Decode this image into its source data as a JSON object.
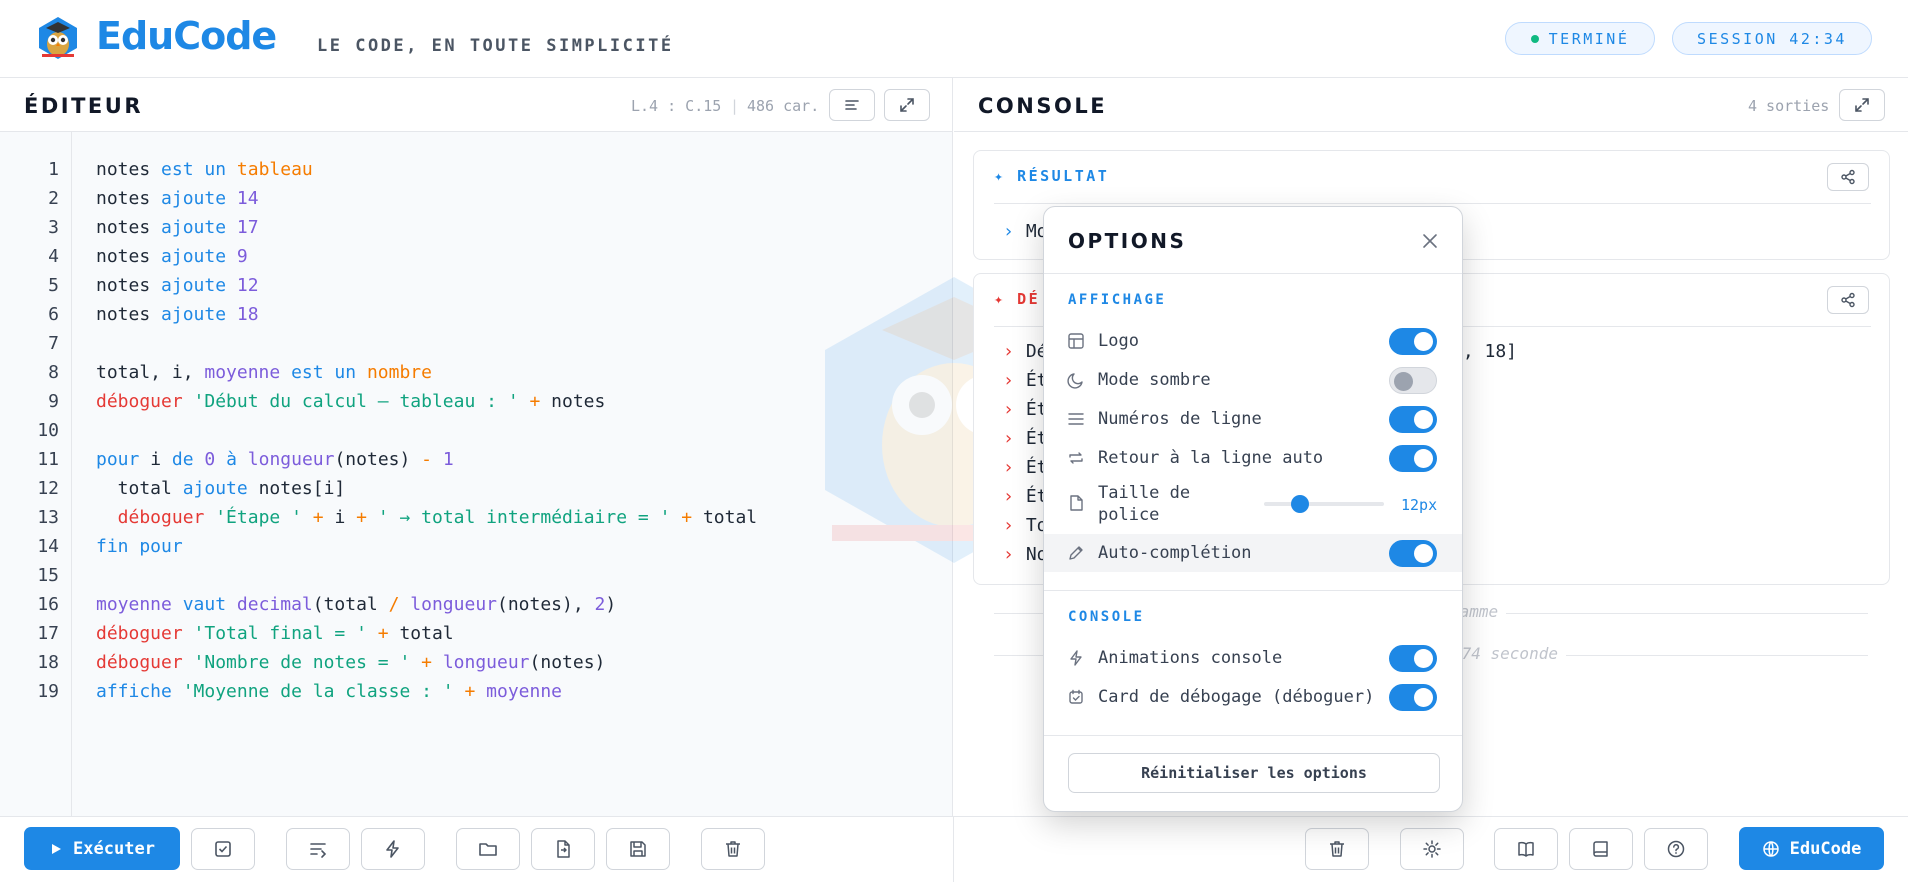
{
  "header": {
    "brand": "EduCode",
    "tagline": "LE CODE, EN TOUTE SIMPLICITÉ",
    "status_badge": "TERMINÉ",
    "session_badge": "SESSION 42:34"
  },
  "editor": {
    "title": "ÉDITEUR",
    "position": "L.4 : C.15",
    "separator": "|",
    "char_count": "486 car.",
    "line_numbers": [
      "1",
      "2",
      "3",
      "4",
      "5",
      "6",
      "7",
      "8",
      "9",
      "10",
      "11",
      "12",
      "13",
      "14",
      "15",
      "16",
      "17",
      "18",
      "19"
    ],
    "code": {
      "l1": [
        "notes ",
        "est un ",
        "tableau"
      ],
      "l2": [
        "notes ",
        "ajoute ",
        "14"
      ],
      "l3": [
        "notes ",
        "ajoute ",
        "17"
      ],
      "l4": [
        "notes ",
        "ajoute ",
        "9"
      ],
      "l5": [
        "notes ",
        "ajoute ",
        "12"
      ],
      "l6": [
        "notes ",
        "ajoute ",
        "18"
      ],
      "l8": [
        "total, i, ",
        "moyenne ",
        "est un ",
        "nombre"
      ],
      "l9": [
        "déboguer ",
        "'Début du calcul — tableau : '",
        " + ",
        "notes"
      ],
      "l11": [
        "pour ",
        "i ",
        "de ",
        "0 ",
        "à ",
        "longueur",
        "(notes) ",
        "- ",
        "1"
      ],
      "l12": [
        "  total ",
        "ajoute ",
        "notes[i]"
      ],
      "l13": [
        "  déboguer ",
        "'Étape '",
        " + ",
        "i ",
        "+ ",
        "' → total intermédiaire = '",
        " + ",
        "total"
      ],
      "l14": [
        "fin pour"
      ],
      "l16": [
        "moyenne ",
        "vaut ",
        "decimal",
        "(total ",
        "/ ",
        "longueur",
        "(notes), ",
        "2",
        ")"
      ],
      "l17": [
        "déboguer ",
        "'Total final = '",
        " + ",
        "total"
      ],
      "l18": [
        "déboguer ",
        "'Nombre de notes = '",
        " + ",
        "longueur",
        "(notes)"
      ],
      "l19": [
        "affiche ",
        "'Moyenne de la classe : '",
        " + ",
        "moyenne"
      ]
    }
  },
  "console": {
    "title": "CONSOLE",
    "output_count": "4 sorties",
    "result_title": "RÉSULTAT",
    "result_line": "Moy",
    "debug_title": "DÉ",
    "debug_lines": [
      "Déb",
      "Éta",
      "Éta",
      "Éta",
      "Éta",
      "Éta",
      "Tot",
      "Nom"
    ],
    "debug_tail": "2, 18]",
    "sep1_text": "ramme",
    "sep2_text": ".74 seconde"
  },
  "footer": {
    "run_label": "Exécuter",
    "brand_button": "EduCode"
  },
  "options": {
    "title": "OPTIONS",
    "section_display": "AFFICHAGE",
    "logo": "Logo",
    "dark_mode": "Mode sombre",
    "line_numbers": "Numéros de ligne",
    "word_wrap": "Retour à la ligne auto",
    "font_size_label": "Taille de police",
    "font_size_value": "12px",
    "font_size_fraction": 0.3,
    "autocomplete": "Auto-complétion",
    "section_console": "CONSOLE",
    "console_animations": "Animations console",
    "debug_card": "Card de débogage (déboguer)",
    "reset": "Réinitialiser les options"
  },
  "colors": {
    "accent": "#1e88e5",
    "success": "#10b981",
    "debug": "#e53935",
    "keyword_type": "#f57c00",
    "number": "#7c5cdb",
    "string": "#10a37f"
  }
}
